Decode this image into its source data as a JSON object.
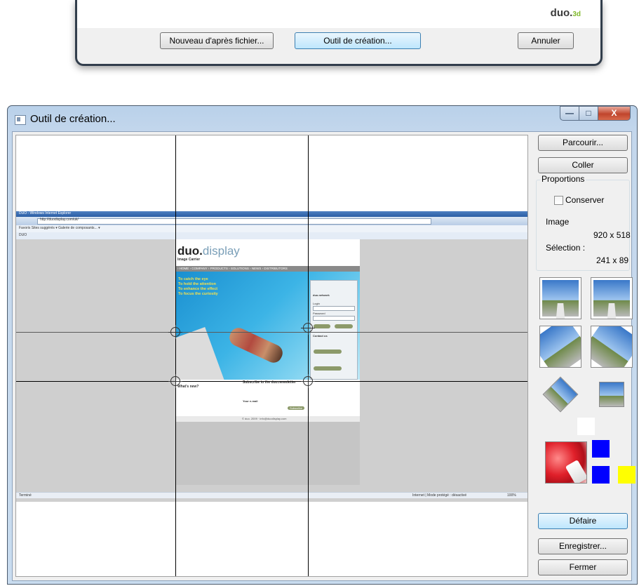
{
  "top_dialog": {
    "logo_main": "duo.",
    "logo_sub": "3d",
    "buttons": {
      "new_from_file": "Nouveau d'après fichier...",
      "creation_tool": "Outil de création...",
      "cancel": "Annuler"
    }
  },
  "window": {
    "title": "Outil de création...",
    "controls": {
      "minimize": "—",
      "maximize": "□",
      "close": "X"
    }
  },
  "preview": {
    "browser_title": "DUO - Windows Internet Explorer",
    "address": "http://duodisplay.com/uk/",
    "favorites_bar": "Favoris    Sites suggérés ▾    Galerie de composants... ▾",
    "tab_label": "DUO",
    "site_logo_main": "duo.",
    "site_logo_accent": "display",
    "site_carrier": "Image Carrier",
    "site_nav": "› HOME  › COMPANY  › PRODUCTS  › SOLUTIONS  › NEWS  › DISTRIBUTORS",
    "hero_lines": [
      "To catch the eye",
      "To hold the attention",
      "To enhance the effect",
      "To focus the curiosity"
    ],
    "login_title": "duo.network",
    "login_label": "Login",
    "password_label": "Password",
    "contact_title": "Contact us",
    "news_title": "What's new?",
    "newsletter_title": "Subscribe to the duo.newsletter",
    "your_email": "Your e-mail",
    "subscribe": "Subscribe",
    "footer": "© duo. 2009 · info@duodisplay.com",
    "status_left": "Terminé",
    "status_right": "Internet | Mode protégé : désactivé",
    "status_zoom": "100%"
  },
  "panel": {
    "browse": "Parcourir...",
    "paste": "Coller",
    "proportions_label": "Proportions",
    "keep_label": "Conserver",
    "image_label": "Image",
    "image_size": "920 x 518",
    "selection_label": "Sélection :",
    "selection_size": "241 x 89",
    "undo": "Défaire",
    "save": "Enregistrer...",
    "close": "Fermer"
  },
  "swatches": {
    "white": "#ffffff",
    "blue_top": "#0000ff",
    "blue_bottom": "#0000ff",
    "yellow": "#ffff00"
  },
  "thumbnails": [
    "road-upright",
    "road-mirrored",
    "road-rotated-left",
    "road-rotated-right",
    "road-diamond",
    "road-diamond-mirrored"
  ]
}
